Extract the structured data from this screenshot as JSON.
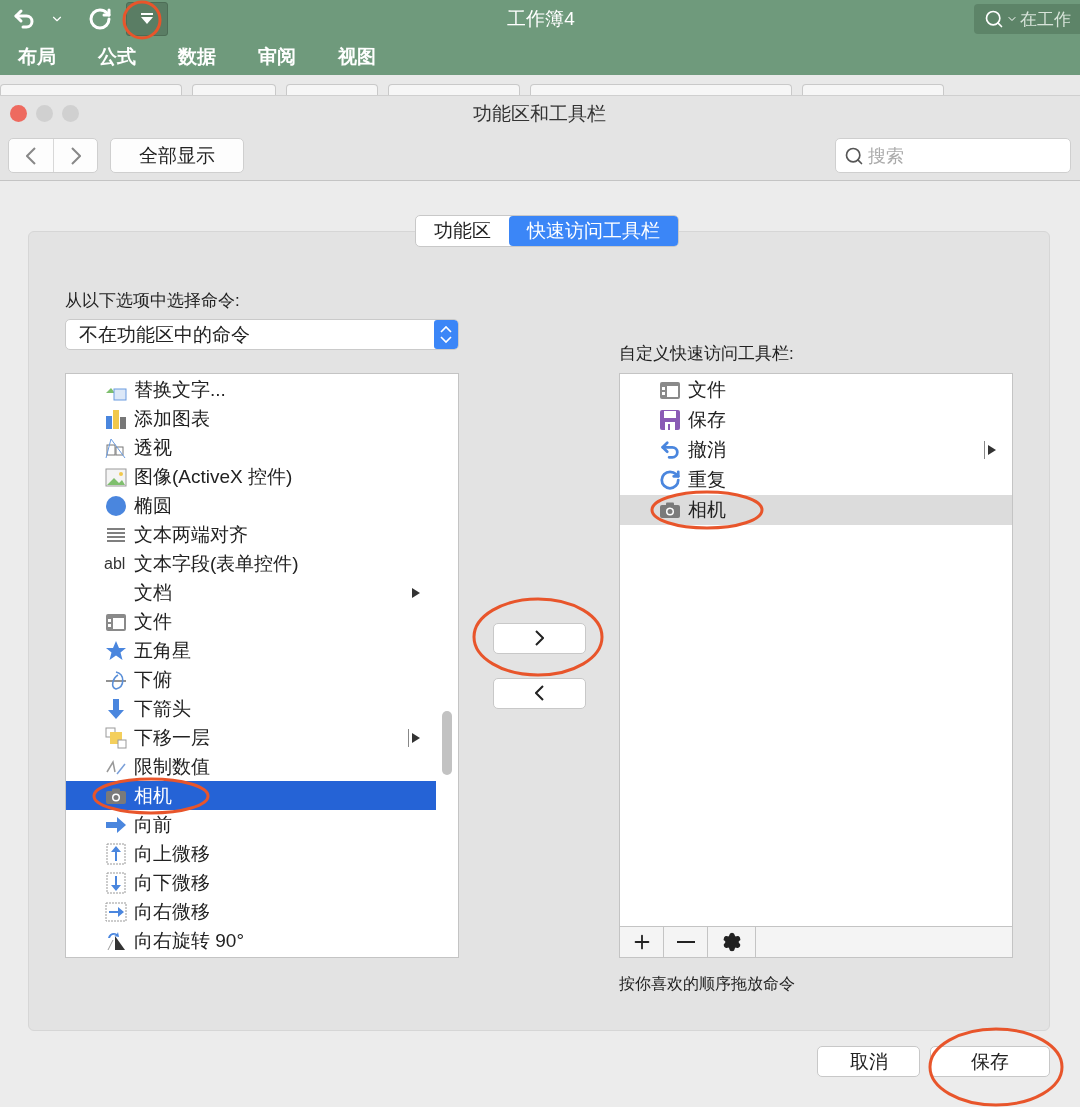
{
  "excel": {
    "title": "工作簿4",
    "search": {
      "placeholder": "在工作"
    },
    "tabs": [
      {
        "label": "布局",
        "selected": false
      },
      {
        "label": "公式",
        "selected": false
      },
      {
        "label": "数据",
        "selected": false
      },
      {
        "label": "审阅",
        "selected": false
      },
      {
        "label": "视图",
        "selected": false
      }
    ]
  },
  "dialog": {
    "title": "功能区和工具栏",
    "show_all": "全部显示",
    "search": {
      "placeholder": "搜索"
    },
    "segments": [
      {
        "label": "功能区",
        "selected": false
      },
      {
        "label": "快速访问工具栏",
        "selected": true
      }
    ],
    "left": {
      "label": "从以下选项中选择命令:",
      "popup": "不在功能区中的命令",
      "items": [
        {
          "label": "替换文字...",
          "selected": false
        },
        {
          "label": "添加图表",
          "selected": false
        },
        {
          "label": "透视",
          "selected": false
        },
        {
          "label": "图像(ActiveX 控件)",
          "selected": false
        },
        {
          "label": "椭圆",
          "selected": false
        },
        {
          "label": "文本两端对齐",
          "selected": false
        },
        {
          "label": "文本字段(表单控件)",
          "selected": false,
          "glyph": "abl"
        },
        {
          "label": "文档",
          "selected": false,
          "submenu": true
        },
        {
          "label": "文件",
          "selected": false
        },
        {
          "label": "五角星",
          "selected": false
        },
        {
          "label": "下俯",
          "selected": false
        },
        {
          "label": "下箭头",
          "selected": false
        },
        {
          "label": "下移一层",
          "selected": false,
          "submenu": true,
          "split": true
        },
        {
          "label": "限制数值",
          "selected": false
        },
        {
          "label": "相机",
          "selected": true
        },
        {
          "label": "向前",
          "selected": false
        },
        {
          "label": "向上微移",
          "selected": false
        },
        {
          "label": "向下微移",
          "selected": false
        },
        {
          "label": "向右微移",
          "selected": false
        },
        {
          "label": "向右旋转 90°",
          "selected": false
        }
      ]
    },
    "right": {
      "label": "自定义快速访问工具栏:",
      "items": [
        {
          "label": "文件",
          "selected": false
        },
        {
          "label": "保存",
          "selected": false
        },
        {
          "label": "撤消",
          "selected": false,
          "submenu": true,
          "split": true
        },
        {
          "label": "重复",
          "selected": false
        },
        {
          "label": "相机",
          "selected": true
        }
      ],
      "hint": "按你喜欢的顺序拖放命令"
    },
    "buttons": [
      "取消",
      "保存"
    ]
  }
}
